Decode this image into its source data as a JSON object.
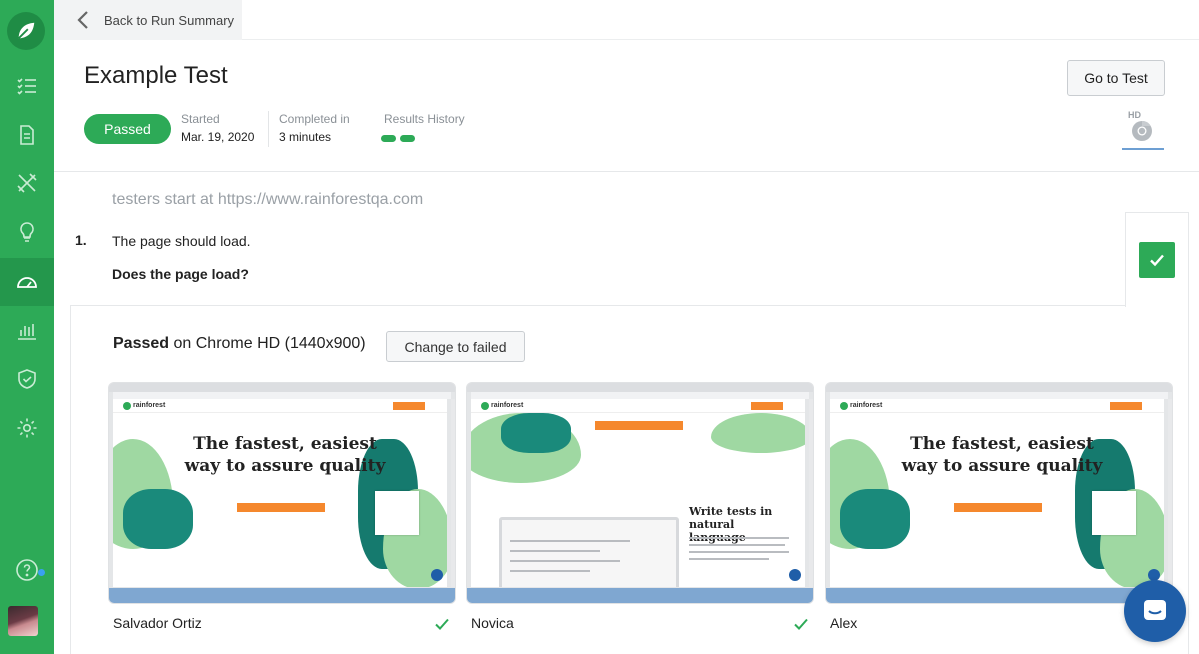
{
  "header": {
    "back_label": "Back to Run Summary",
    "title": "Example Test",
    "goto_button": "Go to Test"
  },
  "status": {
    "badge": "Passed",
    "started_label": "Started",
    "started_value": "Mar. 19, 2020",
    "completed_label": "Completed in",
    "completed_value": "3 minutes",
    "history_label": "Results History",
    "history_results": [
      "passed",
      "passed"
    ]
  },
  "browser": {
    "badge_text": "HD",
    "icon": "chrome-icon"
  },
  "step": {
    "start_text": "testers start at https://www.rainforestqa.com",
    "number": "1.",
    "action": "The page should load.",
    "question": "Does the page load?",
    "result": "passed"
  },
  "result": {
    "status_word": "Passed",
    "environment": "on Chrome HD (1440x900)",
    "change_button": "Change to failed"
  },
  "screenshots": [
    {
      "tester": "Salvador Ortiz",
      "verdict": "passed",
      "brand": "rainforest",
      "headline": "The fastest, easiest way to assure quality"
    },
    {
      "tester": "Novica",
      "verdict": "passed",
      "brand": "rainforest",
      "headline": "Write tests in natural language"
    },
    {
      "tester": "Alex",
      "verdict": "passed",
      "brand": "rainforest",
      "headline": "The fastest, easiest way to assure quality"
    }
  ],
  "sidebar": {
    "items": [
      "leaf-logo-icon",
      "checklist-icon",
      "document-icon",
      "tools-icon",
      "lightbulb-icon",
      "dashboard-icon",
      "bar-chart-icon",
      "shield-check-icon",
      "gear-icon"
    ],
    "active": "dashboard-icon",
    "help_icon": "help-icon"
  },
  "colors": {
    "brand_green": "#2daa57",
    "accent_blue": "#1f5ea8",
    "orange": "#f5882d"
  }
}
